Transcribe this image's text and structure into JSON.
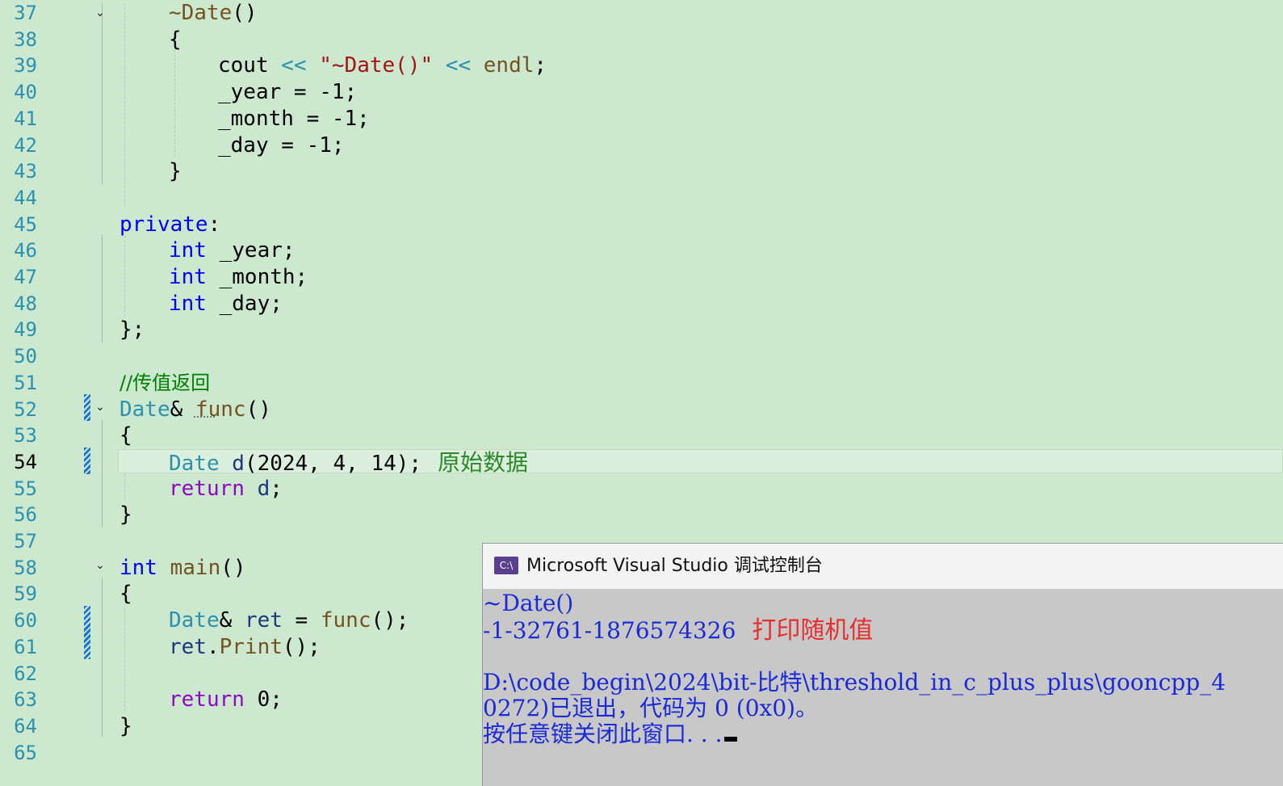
{
  "editor": {
    "lines": [
      {
        "n": "37",
        "indent": 1,
        "tokens": [
          {
            "t": "~Date",
            "c": "fn"
          },
          {
            "t": "()",
            "c": ""
          }
        ]
      },
      {
        "n": "38",
        "indent": 1,
        "tokens": [
          {
            "t": "{",
            "c": ""
          }
        ]
      },
      {
        "n": "39",
        "indent": 2,
        "tokens": [
          {
            "t": "cout ",
            "c": ""
          },
          {
            "t": "<<",
            "c": "ty"
          },
          {
            "t": " ",
            "c": ""
          },
          {
            "t": "\"~Date()\"",
            "c": "st"
          },
          {
            "t": " ",
            "c": ""
          },
          {
            "t": "<<",
            "c": "ty"
          },
          {
            "t": " ",
            "c": ""
          },
          {
            "t": "endl",
            "c": "fn"
          },
          {
            "t": ";",
            "c": ""
          }
        ]
      },
      {
        "n": "40",
        "indent": 2,
        "tokens": [
          {
            "t": "_year = -1;",
            "c": ""
          }
        ]
      },
      {
        "n": "41",
        "indent": 2,
        "tokens": [
          {
            "t": "_month = -1;",
            "c": ""
          }
        ]
      },
      {
        "n": "42",
        "indent": 2,
        "tokens": [
          {
            "t": "_day = -1;",
            "c": ""
          }
        ]
      },
      {
        "n": "43",
        "indent": 1,
        "tokens": [
          {
            "t": "}",
            "c": ""
          }
        ]
      },
      {
        "n": "44",
        "indent": 0,
        "tokens": []
      },
      {
        "n": "45",
        "indent": 0,
        "tokens": [
          {
            "t": "private",
            "c": "kw"
          },
          {
            "t": ":",
            "c": ""
          }
        ]
      },
      {
        "n": "46",
        "indent": 1,
        "tokens": [
          {
            "t": "int",
            "c": "kw"
          },
          {
            "t": " _year;",
            "c": ""
          }
        ]
      },
      {
        "n": "47",
        "indent": 1,
        "tokens": [
          {
            "t": "int",
            "c": "kw"
          },
          {
            "t": " _month;",
            "c": ""
          }
        ]
      },
      {
        "n": "48",
        "indent": 1,
        "tokens": [
          {
            "t": "int",
            "c": "kw"
          },
          {
            "t": " _day;",
            "c": ""
          }
        ]
      },
      {
        "n": "49",
        "indent": 0,
        "tokens": [
          {
            "t": "};",
            "c": ""
          }
        ]
      },
      {
        "n": "50",
        "indent": 0,
        "tokens": []
      },
      {
        "n": "51",
        "indent": 0,
        "tokens": [
          {
            "t": "//传值返回",
            "c": "cm"
          }
        ]
      },
      {
        "n": "52",
        "indent": 0,
        "tokens": [
          {
            "t": "Date",
            "c": "ty"
          },
          {
            "t": "& ",
            "c": ""
          },
          {
            "t": "func",
            "c": "fn"
          },
          {
            "t": "()",
            "c": ""
          }
        ]
      },
      {
        "n": "53",
        "indent": 0,
        "tokens": [
          {
            "t": "{",
            "c": ""
          }
        ]
      },
      {
        "n": "54",
        "indent": 1,
        "tokens": [
          {
            "t": "Date",
            "c": "ty"
          },
          {
            "t": " ",
            "c": ""
          },
          {
            "t": "d",
            "c": "va"
          },
          {
            "t": "(2024, 4, 14);",
            "c": ""
          }
        ],
        "note": "原始数据"
      },
      {
        "n": "55",
        "indent": 1,
        "tokens": [
          {
            "t": "return",
            "c": "ctl"
          },
          {
            "t": " ",
            "c": ""
          },
          {
            "t": "d",
            "c": "va"
          },
          {
            "t": ";",
            "c": ""
          }
        ]
      },
      {
        "n": "56",
        "indent": 0,
        "tokens": [
          {
            "t": "}",
            "c": ""
          }
        ]
      },
      {
        "n": "57",
        "indent": 0,
        "tokens": []
      },
      {
        "n": "58",
        "indent": 0,
        "tokens": [
          {
            "t": "int",
            "c": "kw"
          },
          {
            "t": " ",
            "c": ""
          },
          {
            "t": "main",
            "c": "fn"
          },
          {
            "t": "()",
            "c": ""
          }
        ]
      },
      {
        "n": "59",
        "indent": 0,
        "tokens": [
          {
            "t": "{",
            "c": ""
          }
        ]
      },
      {
        "n": "60",
        "indent": 1,
        "tokens": [
          {
            "t": "Date",
            "c": "ty"
          },
          {
            "t": "& ",
            "c": ""
          },
          {
            "t": "ret",
            "c": "va"
          },
          {
            "t": " = ",
            "c": ""
          },
          {
            "t": "func",
            "c": "fn"
          },
          {
            "t": "();",
            "c": ""
          }
        ]
      },
      {
        "n": "61",
        "indent": 1,
        "tokens": [
          {
            "t": "ret",
            "c": "va"
          },
          {
            "t": ".",
            "c": ""
          },
          {
            "t": "Print",
            "c": "fn"
          },
          {
            "t": "();",
            "c": ""
          }
        ]
      },
      {
        "n": "62",
        "indent": 0,
        "tokens": []
      },
      {
        "n": "63",
        "indent": 1,
        "tokens": [
          {
            "t": "return",
            "c": "ctl"
          },
          {
            "t": " 0;",
            "c": ""
          }
        ]
      },
      {
        "n": "64",
        "indent": 0,
        "tokens": [
          {
            "t": "}",
            "c": ""
          }
        ]
      },
      {
        "n": "65",
        "indent": 0,
        "tokens": []
      }
    ],
    "current_line": "54",
    "colors": {
      "background": "#cce8cf",
      "keyword": "#0000ff",
      "type": "#2b91af",
      "function": "#74531f",
      "string": "#a31515",
      "control": "#8f08c4",
      "comment": "#008000",
      "change_marker": "#1e73d6"
    }
  },
  "console": {
    "icon": "console-app-icon",
    "icon_text": "C:\\",
    "title": "Microsoft Visual Studio 调试控制台",
    "lines": {
      "l1": "~Date()",
      "l2": "-1-32761-1876574326",
      "l2_note": "打印随机值",
      "l3": "D:\\code_begin\\2024\\bit-比特\\threshold_in_c_plus_plus\\gooncpp_4",
      "l4": "0272)已退出，代码为 0 (0x0)。",
      "l5": "按任意键关闭此窗口. . ."
    }
  }
}
